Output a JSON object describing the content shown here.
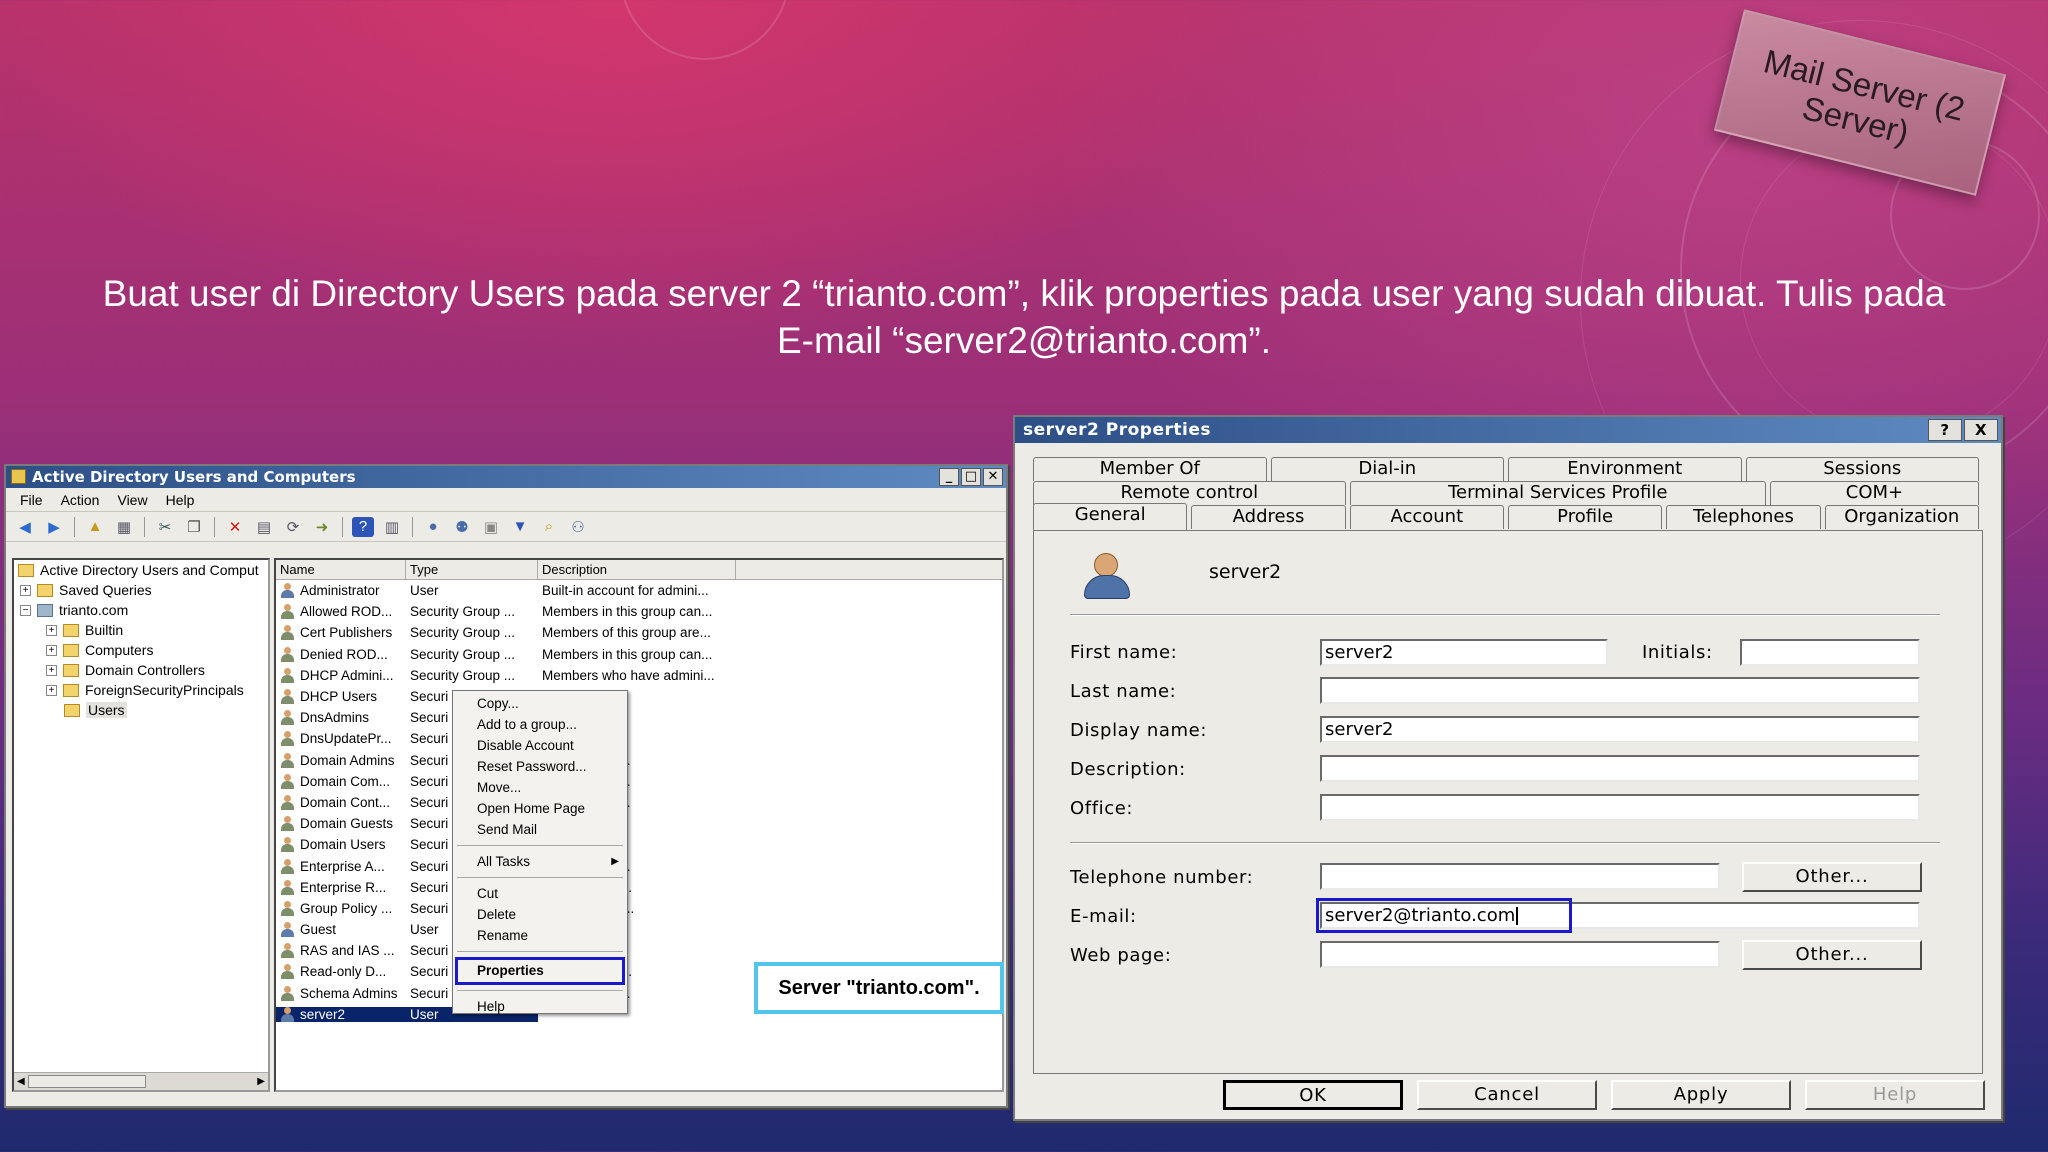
{
  "slide": {
    "instruction": "Buat user di Directory Users pada server 2 “trianto.com”, klik properties pada user yang sudah dibuat. Tulis pada E-mail “server2@trianto.com”.",
    "stamp": "Mail Server (2 Server)",
    "callout": "Server \"trianto.com\"."
  },
  "ad_window": {
    "title": "Active Directory Users and Computers",
    "menu": [
      "File",
      "Action",
      "View",
      "Help"
    ],
    "tree": {
      "root": "Active Directory Users and Comput",
      "saved_queries": "Saved Queries",
      "domain": "trianto.com",
      "children": [
        "Builtin",
        "Computers",
        "Domain Controllers",
        "ForeignSecurityPrincipals",
        "Users"
      ],
      "selected": "Users"
    },
    "columns": [
      "Name",
      "Type",
      "Description"
    ],
    "rows": [
      {
        "name": "Administrator",
        "type": "User",
        "desc": "Built-in account for admini...",
        "kind": "user"
      },
      {
        "name": "Allowed ROD...",
        "type": "Security Group ...",
        "desc": "Members in this group can...",
        "kind": "group"
      },
      {
        "name": "Cert Publishers",
        "type": "Security Group ...",
        "desc": "Members of this group are...",
        "kind": "group"
      },
      {
        "name": "Denied ROD...",
        "type": "Security Group ...",
        "desc": "Members in this group can...",
        "kind": "group"
      },
      {
        "name": "DHCP Admini...",
        "type": "Security Group ...",
        "desc": "Members who have admini...",
        "kind": "group"
      },
      {
        "name": "DHCP Users",
        "type": "Securi",
        "desc": "have view-...",
        "kind": "group"
      },
      {
        "name": "DnsAdmins",
        "type": "Securi",
        "desc": "rators Group",
        "kind": "group"
      },
      {
        "name": "DnsUpdatePr...",
        "type": "Securi",
        "desc": "ho are permi...",
        "kind": "group"
      },
      {
        "name": "Domain Admins",
        "type": "Securi",
        "desc": "dministrators...",
        "kind": "group"
      },
      {
        "name": "Domain Com...",
        "type": "Securi",
        "desc": "ns and serve...",
        "kind": "group"
      },
      {
        "name": "Domain Cont...",
        "type": "Securi",
        "desc": "ntrollers in th...",
        "kind": "group"
      },
      {
        "name": "Domain Guests",
        "type": "Securi",
        "desc": "ests",
        "kind": "group"
      },
      {
        "name": "Domain Users",
        "type": "Securi",
        "desc": "rs",
        "kind": "group"
      },
      {
        "name": "Enterprise A...",
        "type": "Securi",
        "desc": "dministrators...",
        "kind": "group"
      },
      {
        "name": "Enterprise R...",
        "type": "Securi",
        "desc": "his group are...",
        "kind": "group"
      },
      {
        "name": "Group Policy ...",
        "type": "Securi",
        "desc": "his group can...",
        "kind": "group"
      },
      {
        "name": "Guest",
        "type": "User",
        "desc": "nt for guest ...",
        "kind": "user"
      },
      {
        "name": "RAS and IAS ...",
        "type": "Securi",
        "desc": "s group can ...",
        "kind": "group"
      },
      {
        "name": "Read-only D...",
        "type": "Securi",
        "desc": "his group are...",
        "kind": "group"
      },
      {
        "name": "Schema Admins",
        "type": "Securi",
        "desc": "dministrators...",
        "kind": "group"
      },
      {
        "name": "server2",
        "type": "User",
        "desc": "",
        "kind": "user"
      }
    ],
    "context_menu": {
      "group1": [
        "Copy...",
        "Add to a group...",
        "Disable Account",
        "Reset Password...",
        "Move...",
        "Open Home Page",
        "Send Mail"
      ],
      "all_tasks": "All Tasks",
      "group2": [
        "Cut",
        "Delete",
        "Rename"
      ],
      "properties": "Properties",
      "help": "Help"
    }
  },
  "props_window": {
    "title": "server2 Properties",
    "help_btn": "?",
    "close_btn": "X",
    "tabs_row1": [
      "Member Of",
      "Dial-in",
      "Environment",
      "Sessions"
    ],
    "tabs_row2": [
      "Remote control",
      "Terminal Services Profile",
      "COM+"
    ],
    "tabs_row3": [
      "General",
      "Address",
      "Account",
      "Profile",
      "Telephones",
      "Organization"
    ],
    "active_tab": "General",
    "user_name": "server2",
    "labels": {
      "first_name": "First name:",
      "initials": "Initials:",
      "last_name": "Last name:",
      "display_name": "Display name:",
      "description": "Description:",
      "office": "Office:",
      "telephone": "Telephone number:",
      "email": "E-mail:",
      "web_page": "Web page:"
    },
    "values": {
      "first_name": "server2",
      "initials": "",
      "last_name": "",
      "display_name": "server2",
      "description": "",
      "office": "",
      "telephone": "",
      "email": "server2@trianto.com",
      "web_page": ""
    },
    "other_btn": "Other...",
    "buttons": {
      "ok": "OK",
      "cancel": "Cancel",
      "apply": "Apply",
      "help": "Help"
    }
  }
}
